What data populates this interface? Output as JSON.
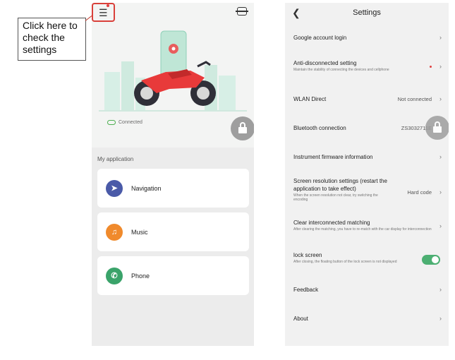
{
  "callout": {
    "text": "Click here to check the settings"
  },
  "left_phone": {
    "status": "Connected",
    "section_title": "My application",
    "apps": [
      {
        "label": "Navigation",
        "icon": "navigation-icon",
        "color": "#4a5aa8"
      },
      {
        "label": "Music",
        "icon": "music-icon",
        "color": "#f08a2c"
      },
      {
        "label": "Phone",
        "icon": "phone-icon",
        "color": "#3aa36a"
      }
    ]
  },
  "settings": {
    "title": "Settings",
    "rows": [
      {
        "title": "Google account login",
        "desc": "",
        "value": ""
      },
      {
        "title": "Anti-disconnected setting",
        "desc": "Maintain the stability of connecting the devices and cellphone",
        "value": ""
      },
      {
        "title": "WLAN Direct",
        "desc": "",
        "value": "Not connected"
      },
      {
        "title": "Bluetooth connection",
        "desc": "",
        "value": "ZS3032711E"
      },
      {
        "title": "Instrument firmware information",
        "desc": "",
        "value": ""
      },
      {
        "title": "Screen resolution settings (restart the application to take effect)",
        "desc": "When the screen resolution not clear, try switching the encoding",
        "value": "Hard code"
      },
      {
        "title": "Clear interconnected matching",
        "desc": "After clearing the matching, you have to re-match with the car display for interconnection",
        "value": ""
      },
      {
        "title": "lock screen",
        "desc": "After closing, the floating button of the lock screen is not displayed",
        "value": ""
      },
      {
        "title": "Feedback",
        "desc": "",
        "value": ""
      },
      {
        "title": "About",
        "desc": "",
        "value": ""
      }
    ],
    "accent_color": "#4caf72"
  }
}
